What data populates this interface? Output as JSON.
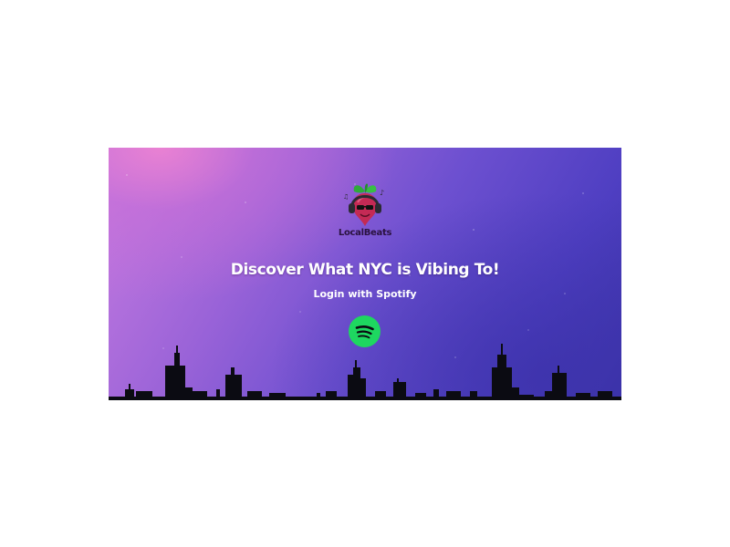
{
  "hero": {
    "brand_name": "LocalBeats",
    "headline": "Discover What NYC is Vibing To!",
    "login_label": "Login with Spotify",
    "logo_icon": "beet-with-headphones-icon",
    "spotify_icon": "spotify-icon"
  },
  "colors": {
    "spotify_green": "#1ed760",
    "gradient_pink": "#c77be0",
    "gradient_indigo": "#3b33a8",
    "text_white": "#ffffff",
    "skyline": "#0b0b12"
  }
}
